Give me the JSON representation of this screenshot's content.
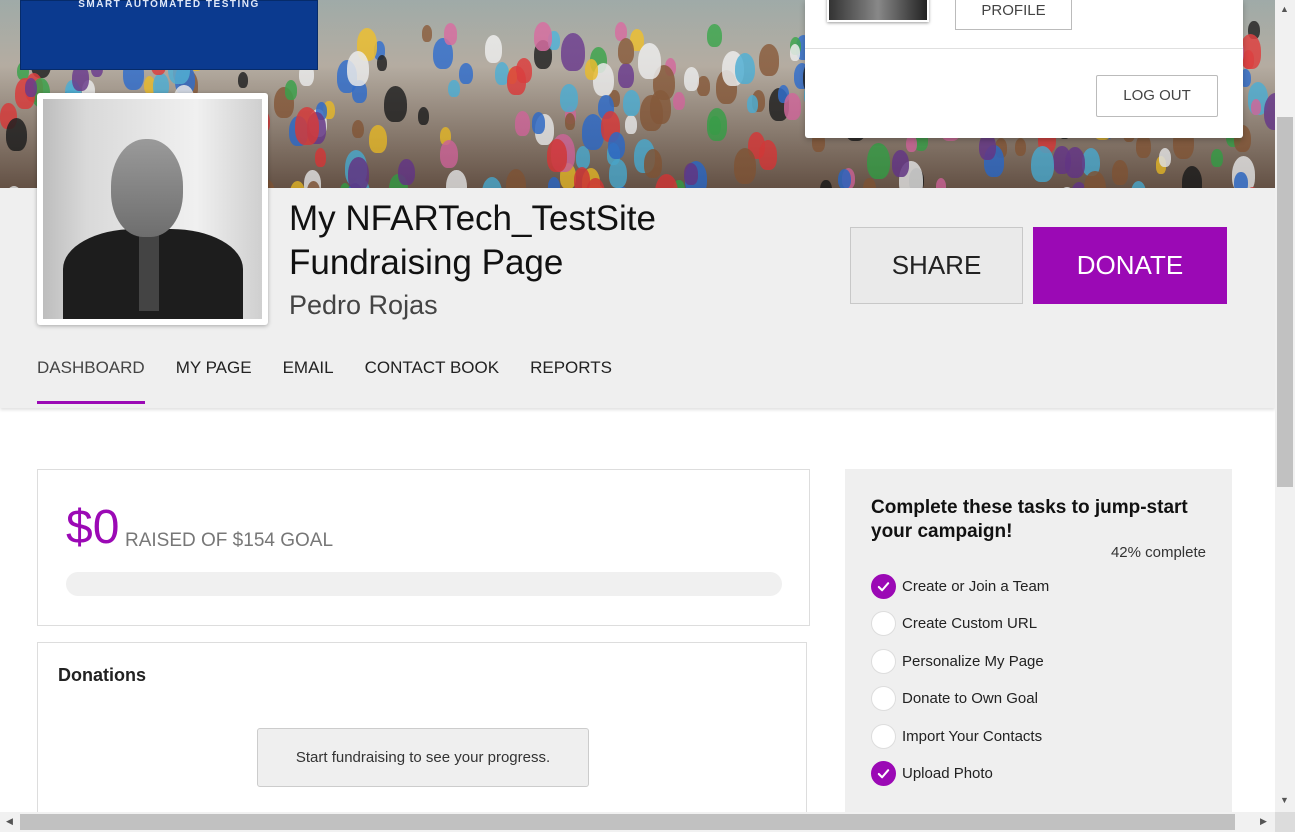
{
  "banner": {
    "logo_text": "SMART AUTOMATED TESTING"
  },
  "profile_menu": {
    "profile_label": "PROFILE",
    "logout_label": "LOG OUT"
  },
  "page": {
    "title": "My NFARTech_TestSite Fundraising Page",
    "owner": "Pedro Rojas"
  },
  "actions": {
    "share_label": "SHARE",
    "donate_label": "DONATE"
  },
  "nav": [
    {
      "label": "DASHBOARD",
      "active": true
    },
    {
      "label": "MY PAGE",
      "active": false
    },
    {
      "label": "EMAIL",
      "active": false
    },
    {
      "label": "CONTACT BOOK",
      "active": false
    },
    {
      "label": "REPORTS",
      "active": false
    }
  ],
  "goal": {
    "raised": "$0",
    "label": "RAISED OF $154 GOAL",
    "progress_fraction": 0
  },
  "donations": {
    "title": "Donations",
    "empty_message": "Start fundraising to see your progress."
  },
  "tasks": {
    "title": "Complete these tasks to jump-start your campaign!",
    "progress_text": "42% complete",
    "items": [
      {
        "label": "Create or Join a Team",
        "done": true
      },
      {
        "label": "Create Custom URL",
        "done": false
      },
      {
        "label": "Personalize My Page",
        "done": false
      },
      {
        "label": "Donate to Own Goal",
        "done": false
      },
      {
        "label": "Import Your Contacts",
        "done": false
      },
      {
        "label": "Upload Photo",
        "done": true
      }
    ]
  },
  "colors": {
    "accent": "#9b09b5",
    "band": "#efefef",
    "logo_bg": "#0b3a8f"
  }
}
